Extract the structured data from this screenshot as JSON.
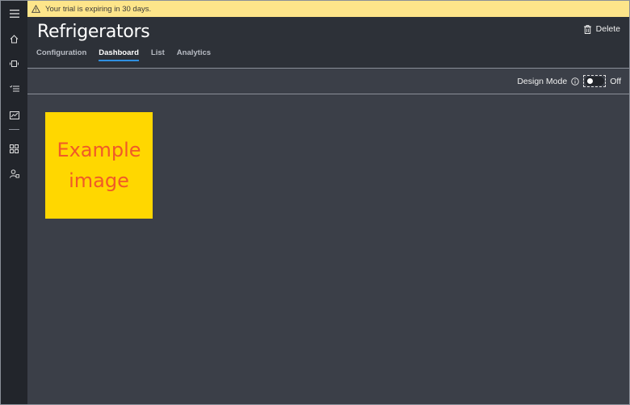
{
  "banner": {
    "message": "Your trial is expiring in 30 days.",
    "icon": "warning-icon"
  },
  "sidebar": {
    "items": [
      {
        "name": "menu",
        "icon": "hamburger-icon"
      },
      {
        "name": "home",
        "icon": "home-icon"
      },
      {
        "name": "devices",
        "icon": "device-icon"
      },
      {
        "name": "rules",
        "icon": "rules-icon"
      },
      {
        "name": "analytics",
        "icon": "analytics-icon"
      },
      {
        "name": "dashboard",
        "icon": "grid-icon"
      },
      {
        "name": "administration",
        "icon": "admin-icon"
      }
    ]
  },
  "header": {
    "title": "Refrigerators",
    "delete_label": "Delete",
    "tabs": [
      {
        "label": "Configuration",
        "active": false
      },
      {
        "label": "Dashboard",
        "active": true
      },
      {
        "label": "List",
        "active": false
      },
      {
        "label": "Analytics",
        "active": false
      }
    ]
  },
  "toolbar": {
    "design_mode_label": "Design Mode",
    "design_mode_state": "Off",
    "design_mode_on": false
  },
  "dashboard": {
    "tile_text": "Example image",
    "tile_background": "#ffd700",
    "tile_text_color": "#f05a28"
  },
  "colors": {
    "banner": "#fde58a",
    "header": "#2d3138",
    "canvas": "#3b3f48",
    "sidebar": "#22252b",
    "accent": "#2f8fe0"
  }
}
